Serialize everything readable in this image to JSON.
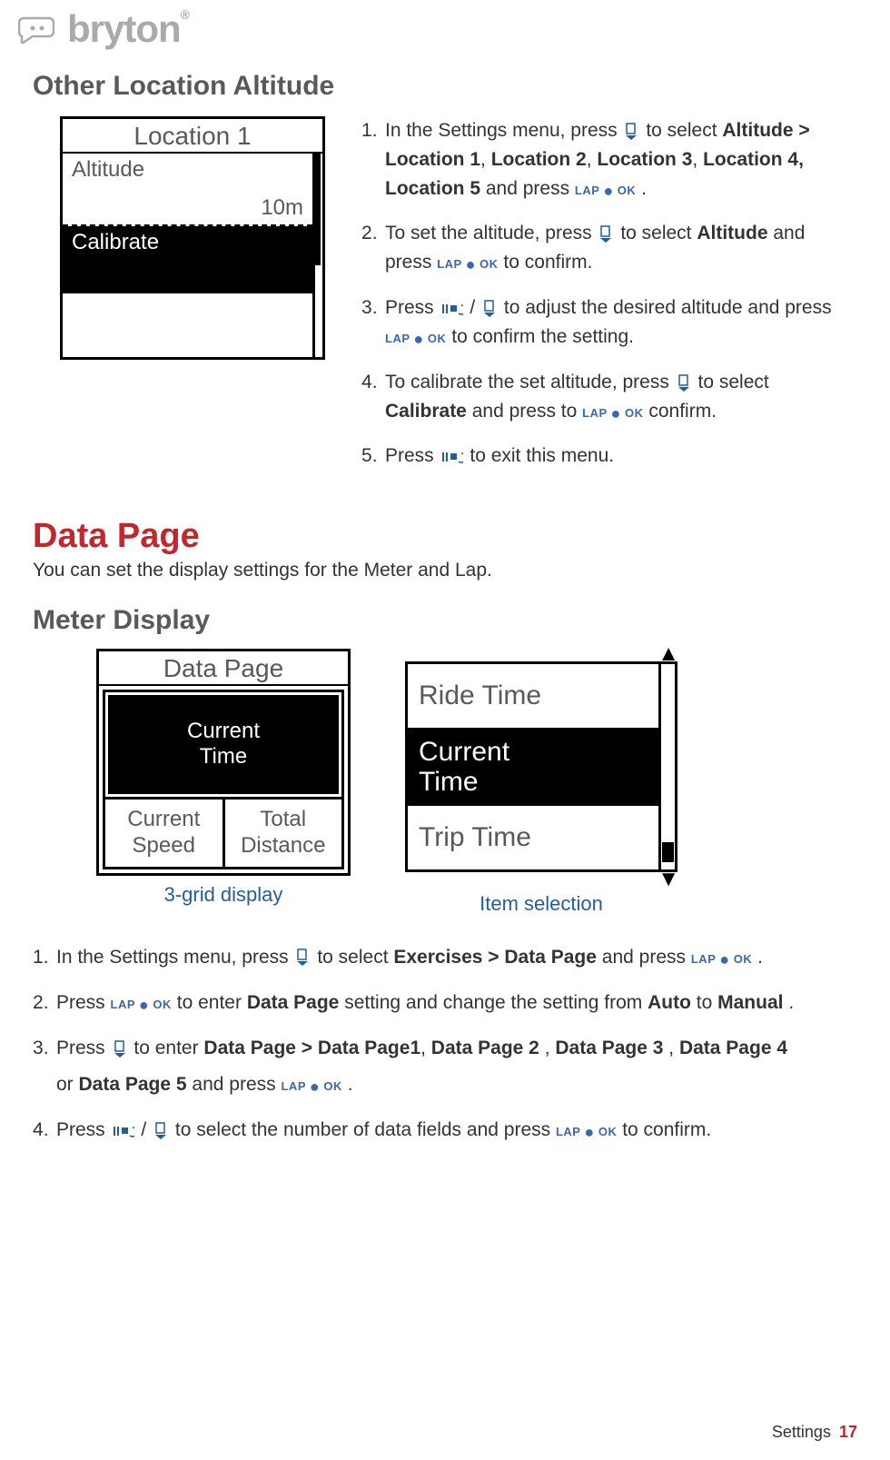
{
  "brand": "bryton",
  "section1_title": "Other Location Altitude",
  "location_screen": {
    "title": "Location 1",
    "altitude_label": "Altitude",
    "altitude_value": "10m",
    "calibrate_label": "Calibrate"
  },
  "altitude_steps": [
    {
      "pre": "In the Settings menu, press ",
      "mid": " to select ",
      "bold": "Altitude > Location 1",
      "after_bold": ", ",
      "bold2": "Location 2",
      "after2": ", ",
      "bold3": "Location 3",
      "after3": ", ",
      "bold4": "Location 4, Location 5",
      "after4": " and press ",
      "tail": " ."
    },
    {
      "pre": "To set the altitude, press ",
      "mid": " to select ",
      "bold": "Altitude",
      "after": " and press ",
      "tail": " to confirm."
    },
    {
      "pre": "Press ",
      "mid": " / ",
      "after": " to adjust the desired altitude and press ",
      "tail": " to confirm the setting."
    },
    {
      "pre": "To calibrate the set altitude, press ",
      "mid": " to select ",
      "bold": "Calibrate",
      "after": " and press to ",
      "tail": " confirm."
    },
    {
      "pre": "Press ",
      "after": " to exit this menu."
    }
  ],
  "data_page_heading": "Data Page",
  "data_page_sub": "You can set the display settings for the Meter and Lap.",
  "meter_display_heading": "Meter Display",
  "screen2": {
    "title": "Data Page",
    "selected": "Current\nTime",
    "cell1": "Current\nSpeed",
    "cell2": "Total\nDistance",
    "caption": "3-grid display"
  },
  "screen3": {
    "item1": "Ride Time",
    "item_sel": "Current\nTime",
    "item3": "Trip Time",
    "caption": "Item selection"
  },
  "meter_steps": [
    {
      "pre": "In the Settings menu, press ",
      "mid": " to select ",
      "bold": "Exercises > Data Page",
      "after": " and press ",
      "tail": " ."
    },
    {
      "pre": "Press ",
      "mid": " to enter ",
      "bold": "Data Page",
      "after": " setting and change the setting from ",
      "bold2": "Auto",
      "after2": " to ",
      "bold3": "Manual",
      "tail": "."
    },
    {
      "pre": "Press ",
      "mid": " to enter ",
      "bold": "Data Page > Data Page1",
      "after": ", ",
      "bold2": "Data Page 2",
      "after2": " , ",
      "bold3": "Data Page 3",
      "after3": " , ",
      "bold4": "Data Page 4",
      "line2_pre": "or ",
      "bold5": "Data Page 5",
      "line2_mid": " and press ",
      "tail": " ."
    },
    {
      "pre": "Press ",
      "mid": " / ",
      "after": " to select the number of data fields and press ",
      "tail": " to confirm."
    }
  ],
  "lap_ok": "LAP ● OK",
  "footer_label": "Settings",
  "footer_page": "17"
}
